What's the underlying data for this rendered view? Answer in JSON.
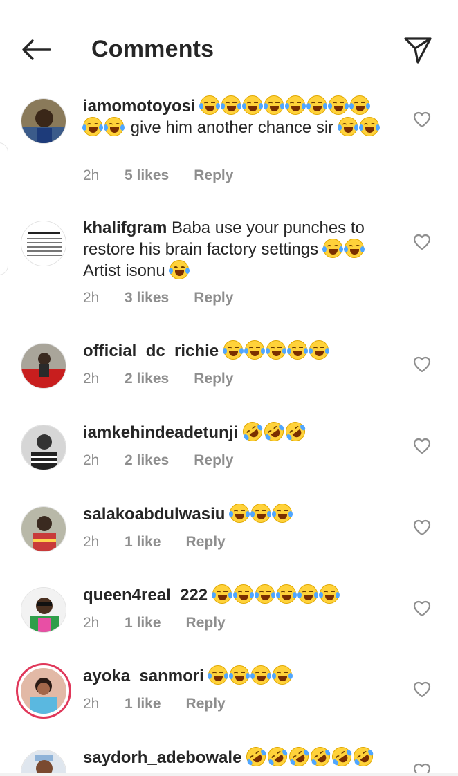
{
  "header": {
    "title": "Comments",
    "back_icon": "arrow-left-icon",
    "share_icon": "paper-plane-icon"
  },
  "colors": {
    "text": "#262626",
    "muted": "#8e8e8e",
    "story_ring": "#e0385a"
  },
  "comments": [
    {
      "username": "iamomotoyosi",
      "pre_emojis": 10,
      "text": "give him another chance sir",
      "post_emojis": 2,
      "time": "2h",
      "likes": "5 likes",
      "reply": "Reply",
      "emoji_type": "joy"
    },
    {
      "username": "khalifgram",
      "text": "Baba use your punches to restore his brain factory settings",
      "mid_emojis": 2,
      "text2": "Artist isonu",
      "post_emojis": 1,
      "time": "2h",
      "likes": "3 likes",
      "reply": "Reply",
      "emoji_type": "joy"
    },
    {
      "username": "official_dc_richie",
      "post_emojis": 5,
      "time": "2h",
      "likes": "2 likes",
      "reply": "Reply",
      "emoji_type": "joy"
    },
    {
      "username": "iamkehindeadetunji",
      "post_emojis": 3,
      "time": "2h",
      "likes": "2 likes",
      "reply": "Reply",
      "emoji_type": "rofl"
    },
    {
      "username": "salakoabdulwasiu",
      "post_emojis": 3,
      "time": "2h",
      "likes": "1 like",
      "reply": "Reply",
      "emoji_type": "joy"
    },
    {
      "username": "queen4real_222",
      "post_emojis": 6,
      "time": "2h",
      "likes": "1 like",
      "reply": "Reply",
      "emoji_type": "joy"
    },
    {
      "username": "ayoka_sanmori",
      "post_emojis": 4,
      "time": "2h",
      "likes": "1 like",
      "reply": "Reply",
      "emoji_type": "joy"
    },
    {
      "username": "saydorh_adebowale",
      "post_emojis": 6,
      "emoji_type": "rofl"
    }
  ]
}
